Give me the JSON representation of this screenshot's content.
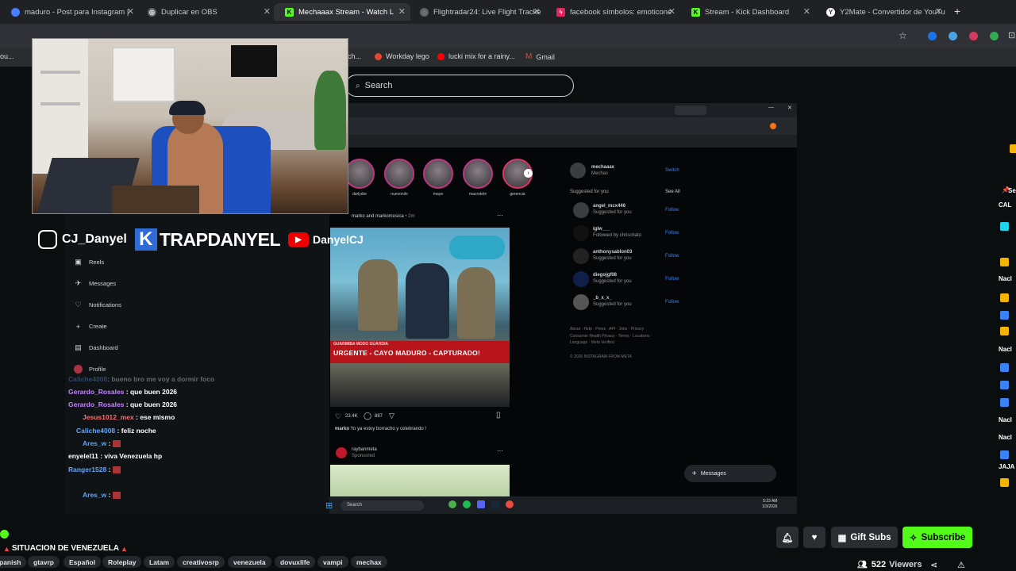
{
  "browser": {
    "tabs": [
      {
        "label": "maduro - Post para Instagram |",
        "icon": "maduro-tab-icon",
        "color": "#4a7dff"
      },
      {
        "label": "Duplicar en OBS",
        "icon": "obs-tab-icon",
        "color": "#9aa0a6"
      },
      {
        "label": "Mechaaax Stream - Watch L",
        "icon": "kick-tab-icon",
        "color": "#53fc18"
      },
      {
        "label": "Flightradar24: Live Flight Tracke",
        "icon": "flightradar-tab-icon",
        "color": "#9aa0a6"
      },
      {
        "label": "facebook símbolos: emoticone",
        "icon": "facebook-symbols-tab-icon",
        "color": "#e0245e"
      },
      {
        "label": "Stream - Kick Dashboard",
        "icon": "kick-dashboard-tab-icon",
        "color": "#53fc18"
      },
      {
        "label": "Y2Mate - Convertidor de YouTu",
        "icon": "y2mate-tab-icon",
        "color": "#ffffff"
      }
    ],
    "new_tab": "+",
    "bookmarks": [
      {
        "label": "ou...",
        "color": "#888"
      },
      {
        "label": "ch...",
        "color": "#888"
      },
      {
        "label": "Workday lego",
        "color": "#ea4335"
      },
      {
        "label": "lucki mix for a rainy...",
        "color": "#ff0000"
      },
      {
        "label": "Gmail",
        "color": "#ea4335"
      }
    ]
  },
  "kick": {
    "search_placeholder": "Search",
    "menu_icon": "hamburger-icon"
  },
  "webcam": {
    "socials": {
      "instagram": "CJ_Danyel",
      "kick": "TRAPDANYEL",
      "youtube": "DanyelCJ"
    }
  },
  "stream_content": {
    "nav": [
      {
        "label": "Reels",
        "icon": "reels-icon"
      },
      {
        "label": "Messages",
        "icon": "messages-icon"
      },
      {
        "label": "Notifications",
        "icon": "heart-icon"
      },
      {
        "label": "Create",
        "icon": "plus-icon"
      },
      {
        "label": "Dashboard",
        "icon": "dashboard-icon"
      },
      {
        "label": "Profile",
        "icon": "profile-icon"
      }
    ],
    "chat": [
      {
        "user": "Caliche4008",
        "msg": ": bueno bro me voy a dormir foco",
        "color": "#60a5fa",
        "faded": true
      },
      {
        "user": "Gerardo_Rosales",
        "msg": ": que buen 2026",
        "color": "#c084fc",
        "faded": false
      },
      {
        "user": "Gerardo_Rosales",
        "msg": ": que buen 2026",
        "color": "#c084fc",
        "faded": false
      },
      {
        "user": "Jesus1012_mex",
        "msg": ": ese mismo",
        "color": "#f87171",
        "faded": false
      },
      {
        "user": "Caliche4008",
        "msg": ": feliz noche",
        "color": "#60a5fa",
        "faded": false
      },
      {
        "user": "Ares_w",
        "msg": ":",
        "color": "#60a5fa",
        "faded": false
      },
      {
        "user": "enyelel11",
        "msg": ": viva Venezuela hp",
        "color": "#ffffff",
        "faded": false
      },
      {
        "user": "Ranger1528",
        "msg": ":",
        "color": "#60a5fa",
        "faded": false
      },
      {
        "user": "Ares_w",
        "msg": ":",
        "color": "#60a5fa",
        "faded": false
      }
    ],
    "stories": [
      "darlydor",
      "nuevonilo",
      "maye",
      "macrotele",
      "gerencia"
    ],
    "post": {
      "author": "marko and markomusica",
      "time": "• 2m",
      "news_tag": "GUARIMBA MODO GUARDIA",
      "headline": "URGENTE - CAYO MADURO - CAPTURADO!",
      "likes": "23.4K",
      "comments": "887",
      "caption_user": "marko",
      "caption": "Yo ya estoy borracho y celebrando !"
    },
    "sponsored": {
      "user": "raybanmeta",
      "label": "Sponsored"
    },
    "profile": {
      "user": "mechaaax",
      "name": "Mechas",
      "switch": "Switch"
    },
    "suggested_title": "Suggested for you",
    "see_all": "See All",
    "suggested": [
      {
        "user": "angel_mcx446",
        "sub": "Suggested for you"
      },
      {
        "user": "iglw___",
        "sub": "Followed by chriscbato"
      },
      {
        "user": "anthonysablon03",
        "sub": "Suggested for you"
      },
      {
        "user": "diegojgf08",
        "sub": "Suggested for you"
      },
      {
        "user": "_b_x_x_",
        "sub": "Suggested for you"
      }
    ],
    "follow": "Follow",
    "footer": "About · Help · Press · API · Jobs · Privacy · Consumer Health Privacy · Terms · Locations · Language · Meta Verified",
    "copyright": "© 2026 INSTAGRAM FROM META",
    "messages_pill": "Messages",
    "taskbar_search": "Search",
    "taskbar_time": "5:23 AM",
    "taskbar_date": "1/3/2026"
  },
  "right_chat": [
    {
      "text": "Se",
      "color": "#ffffff"
    },
    {
      "text": "CAL",
      "color": "#ffffff"
    },
    {
      "text": "Nacl",
      "color": "#ffffff"
    },
    {
      "text": "Nacl",
      "color": "#ffffff"
    },
    {
      "text": "Nacl",
      "color": "#ffffff"
    },
    {
      "text": "Nacl",
      "color": "#ffffff"
    },
    {
      "text": "JAJA",
      "color": "#ffffff"
    }
  ],
  "bottom": {
    "title": "SITUACION DE VENEZUELA",
    "tags": [
      "panish",
      "gtavrp",
      "Español",
      "Roleplay",
      "Latam",
      "creativosrp",
      "venezuela",
      "dovuxlife",
      "vampi",
      "mechax"
    ],
    "gift_subs": "Gift Subs",
    "subscribe": "Subscribe",
    "viewers_count": "522",
    "viewers_label": "Viewers"
  },
  "colors": {
    "kick_green": "#53fc18",
    "background": "#0b0e0f",
    "news_red": "#b8141c"
  }
}
